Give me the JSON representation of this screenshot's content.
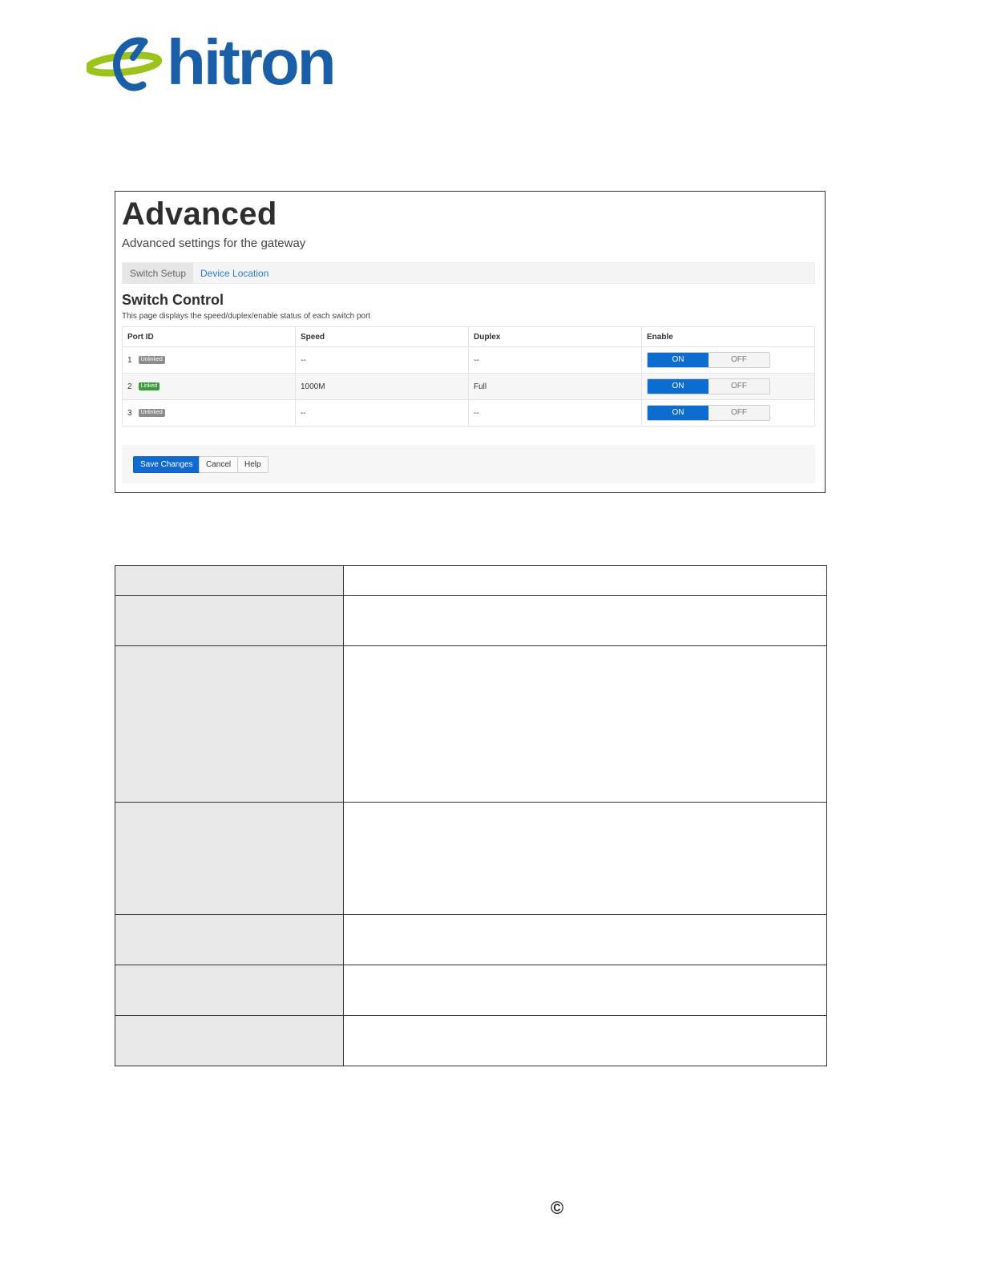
{
  "brand": {
    "name": "hitron",
    "colors": {
      "wordmark": "#1b5ea8",
      "swoosh_green": "#9cc31b",
      "swoosh_blue": "#1b5ea8"
    }
  },
  "screenshot": {
    "title": "Advanced",
    "subtitle": "Advanced settings for the gateway",
    "tabs": [
      {
        "label": "Switch Setup",
        "active": true
      },
      {
        "label": "Device Location",
        "active": false
      }
    ],
    "section_title": "Switch Control",
    "section_desc": "This page displays the speed/duplex/enable status of each switch port",
    "columns": [
      "Port ID",
      "Speed",
      "Duplex",
      "Enable"
    ],
    "rows": [
      {
        "port": "1",
        "status": "Unlinked",
        "status_color": "#8c8c8c",
        "speed": "--",
        "duplex": "--",
        "on_label": "ON",
        "off_label": "OFF",
        "enabled": true
      },
      {
        "port": "2",
        "status": "Linked",
        "status_color": "#3a9a3a",
        "speed": "1000M",
        "duplex": "Full",
        "on_label": "ON",
        "off_label": "OFF",
        "enabled": true
      },
      {
        "port": "3",
        "status": "Unlinked",
        "status_color": "#8c8c8c",
        "speed": "--",
        "duplex": "--",
        "on_label": "ON",
        "off_label": "OFF",
        "enabled": true
      }
    ],
    "buttons": {
      "save": "Save Changes",
      "cancel": "Cancel",
      "help": "Help"
    },
    "accent": "#0d6ccf"
  },
  "footer": {
    "symbol": "©"
  }
}
